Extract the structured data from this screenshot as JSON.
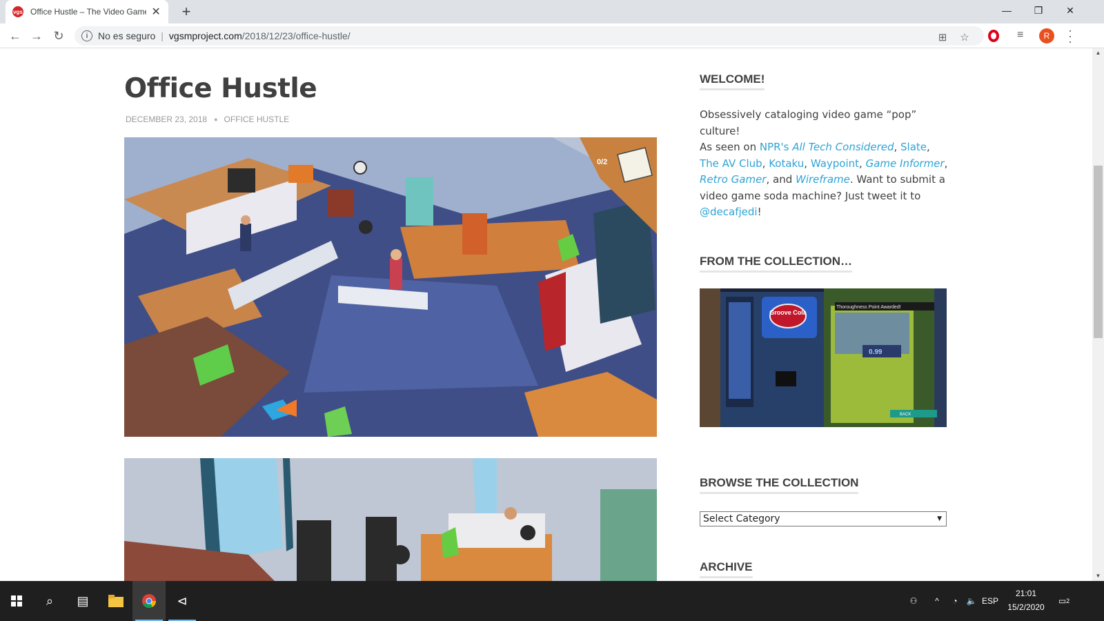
{
  "browser": {
    "tab_title": "Office Hustle – The Video Game Soda Machine Project",
    "favicon_text": "vgs",
    "new_tab": "+",
    "not_secure": "No es seguro",
    "url_host": "vgsmproject.com",
    "url_path": "/2018/12/23/office-hustle/",
    "profile_initial": "R"
  },
  "post": {
    "title": "Office Hustle",
    "date": "DECEMBER 23, 2018",
    "category": "OFFICE HUSTLE",
    "hud_counter": "0/2"
  },
  "sidebar": {
    "welcome": {
      "title": "WELCOME!",
      "tagline": "Obsessively cataloging video game “pop” culture!",
      "p_as_seen": "As seen on ",
      "npr": "NPR's ",
      "all_tech": "All Tech Considered",
      "comma1": ", ",
      "slate": "Slate",
      "comma2": ", ",
      "av_club": "The AV Club",
      "comma3": ", ",
      "kotaku": "Kotaku",
      "comma4": ", ",
      "waypoint": "Waypoint",
      "comma5": ", ",
      "game_informer": "Game Informer",
      "comma6": ", ",
      "retro_gamer": "Retro Gamer",
      "and": ", and ",
      "wireframe": "Wireframe",
      "submit_text": ". Want to submit a video game soda machine? Just tweet it to ",
      "handle": "@decafjedi",
      "excl": "!"
    },
    "collection": {
      "title": "FROM THE COLLECTION…",
      "machine_logo": "Groove Cola",
      "awarded": "Thoroughness Point Awarded!",
      "price": "0.99",
      "back_label": "BACK"
    },
    "browse": {
      "title": "BROWSE THE COLLECTION",
      "select_value": "Select Category"
    },
    "archive": {
      "title": "ARCHIVE"
    }
  },
  "taskbar": {
    "lang": "ESP",
    "time": "21:01",
    "date": "15/2/2020",
    "notifications": "2"
  },
  "colors": {
    "link": "#2ea3d6",
    "heading": "#404040",
    "meta": "#999999",
    "taskbar": "#1f1f1f"
  }
}
